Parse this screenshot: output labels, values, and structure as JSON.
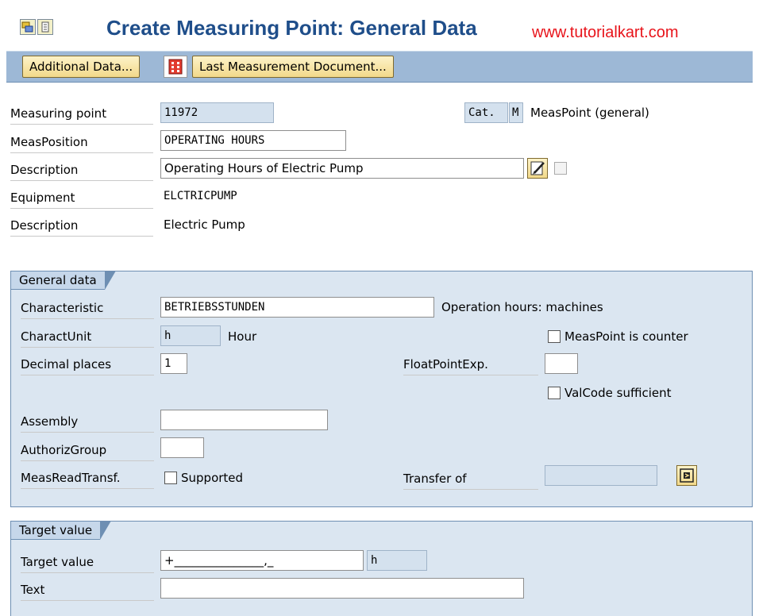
{
  "header": {
    "title": "Create Measuring Point: General Data",
    "watermark": "www.tutorialkart.com"
  },
  "toolbar": {
    "additional_data_label": "Additional Data...",
    "last_document_label": "Last Measurement Document..."
  },
  "header_fields": {
    "measuring_point_label": "Measuring point",
    "measuring_point_value": "11972",
    "category_label": "Cat.",
    "category_value": "M",
    "category_text": "MeasPoint (general)",
    "meas_position_label": "MeasPosition",
    "meas_position_value": "OPERATING HOURS",
    "description_label": "Description",
    "description_value": "Operating Hours of Electric Pump",
    "equipment_label": "Equipment",
    "equipment_value": "ELCTRICPUMP",
    "equipment_description_label": "Description",
    "equipment_description_value": "Electric Pump"
  },
  "general_data": {
    "tab_label": "General data",
    "characteristic_label": "Characteristic",
    "characteristic_value": "BETRIEBSSTUNDEN",
    "characteristic_text": "Operation hours: machines",
    "charact_unit_label": "CharactUnit",
    "charact_unit_value": "h",
    "charact_unit_text": "Hour",
    "meas_point_counter_label": "MeasPoint is counter",
    "decimal_places_label": "Decimal places",
    "decimal_places_value": "1",
    "float_point_exp_label": "FloatPointExp.",
    "float_point_exp_value": "",
    "val_code_sufficient_label": "ValCode sufficient",
    "assembly_label": "Assembly",
    "assembly_value": "",
    "authoriz_group_label": "AuthorizGroup",
    "authoriz_group_value": "",
    "meas_read_transf_label": "MeasReadTransf.",
    "supported_label": "Supported",
    "transfer_of_label": "Transfer of",
    "transfer_of_value": ""
  },
  "target_value": {
    "tab_label": "Target value",
    "target_value_label": "Target value",
    "target_value_value": "+_______________,_",
    "target_value_unit": "h",
    "text_label": "Text",
    "text_value": ""
  },
  "colors": {
    "title": "#1f4e8a",
    "watermark": "#e8141b",
    "toolbar": "#9db8d6",
    "group_bg": "#dbe6f1",
    "readonly_field": "#d4e1ee"
  },
  "icons": [
    "other-objects-icon",
    "display-icon",
    "calculator-icon",
    "long-text-edit-icon",
    "navigate-icon"
  ]
}
